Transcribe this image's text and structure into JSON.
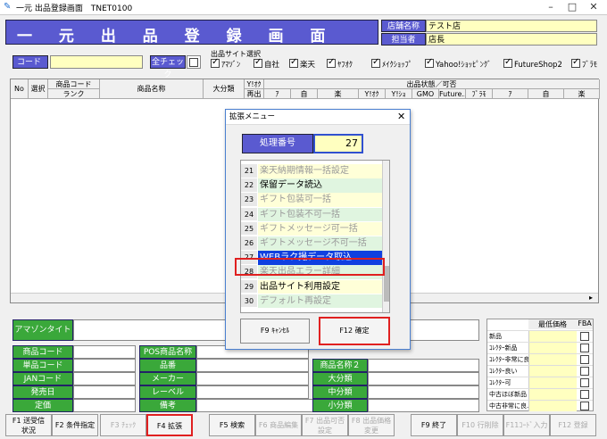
{
  "window": {
    "title": "一元 出品登録画面　TNET0100"
  },
  "header": {
    "title": "一 元 出 品 登 録 画 面",
    "store_label": "店舗名称",
    "store_value": "テスト店",
    "staff_label": "担当者",
    "staff_value": "店長"
  },
  "search": {
    "code_label": "コード",
    "all_check_label": "全チェック",
    "site_group_label": "出品サイト選択",
    "sites": [
      "ｱﾏｿﾞﾝ",
      "自社",
      "楽天",
      "ﾔﾌｵｸ",
      "ﾒｲｸｼｮｯﾌﾟ",
      "Yahoo!ｼｮｯﾋﾟﾝｸﾞ",
      "FutureShop2",
      "ﾌﾞﾗﾓ"
    ]
  },
  "grid": {
    "col_no": "No",
    "col_select": "選択",
    "col_code": "商品コード",
    "col_rank": "ランク",
    "col_name": "商品名称",
    "col_category": "大分類",
    "col_y1": "Y!ｵｸ",
    "col_y2": "再出",
    "status_group": "出品状態／可否",
    "status_cols": [
      "ｱ",
      "自",
      "楽",
      "Y!ｵｸ",
      "Y!ｼｮ",
      "GMO",
      "Future...",
      "ﾌﾞﾗﾓ",
      "ｱ",
      "自",
      "楽"
    ]
  },
  "detail": {
    "amazon_title": "アマゾンタイトル",
    "product_code": "商品コード",
    "single_code": "単品コード",
    "jan": "JANコード",
    "release": "発売日",
    "price": "定価",
    "pos_name": "POS商品名称",
    "item": "品番",
    "maker": "メーカー",
    "label": "レーベル",
    "remarks": "備考",
    "name2": "商品名称２",
    "large_cat": "大分類",
    "mid_cat": "中分類",
    "small_cat": "小分類"
  },
  "price_table": {
    "h1": "最低価格",
    "h2": "FBA",
    "rows": [
      "新品",
      "ｺﾚｸﾀｰ新品",
      "ｺﾚｸﾀｰ非常に良い",
      "ｺﾚｸﾀｰ良い",
      "ｺﾚｸﾀｰ可",
      "中古ほぼ新品",
      "中古非常に良..."
    ]
  },
  "fkeys": [
    {
      "key": "f1",
      "label": "F1 送受信\n状況",
      "enabled": true
    },
    {
      "key": "f2",
      "label": "F2 条件指定",
      "enabled": true
    },
    {
      "key": "f3",
      "label": "F3 ﾁｪｯｸ",
      "enabled": false
    },
    {
      "key": "f4",
      "label": "F4 拡張",
      "enabled": true
    },
    {
      "key": "f5",
      "label": "F5 検索",
      "enabled": true
    },
    {
      "key": "f6",
      "label": "F6 商品編集",
      "enabled": false
    },
    {
      "key": "f7",
      "label": "F7 出品可否\n設定",
      "enabled": false
    },
    {
      "key": "f8",
      "label": "F8 出品価格\n変更",
      "enabled": false
    },
    {
      "key": "f9",
      "label": "F9 終了",
      "enabled": true
    },
    {
      "key": "f10",
      "label": "F10 行削除",
      "enabled": false
    },
    {
      "key": "f11",
      "label": "F11ｺｰﾄﾞ入力",
      "enabled": false
    },
    {
      "key": "f12",
      "label": "F12 登録",
      "enabled": false
    }
  ],
  "dialog": {
    "title": "拡張メニュー",
    "proc_label": "処理番号",
    "proc_value": "27",
    "cancel": "F9 ｷｬﾝｾﾙ",
    "confirm": "F12 確定",
    "items": [
      {
        "no": "21",
        "text": "楽天納期情報一括設定",
        "enabled": false
      },
      {
        "no": "22",
        "text": "保留データ読込",
        "enabled": true
      },
      {
        "no": "23",
        "text": "ギフト包装可一括",
        "enabled": false
      },
      {
        "no": "24",
        "text": "ギフト包装不可一括",
        "enabled": false
      },
      {
        "no": "25",
        "text": "ギフトメッセージ可一括",
        "enabled": false
      },
      {
        "no": "26",
        "text": "ギフトメッセージ不可一括",
        "enabled": false
      },
      {
        "no": "27",
        "text": "WEBラク撮データ取込",
        "enabled": true,
        "selected": true
      },
      {
        "no": "28",
        "text": "楽天出品エラー詳細",
        "enabled": false
      },
      {
        "no": "29",
        "text": "出品サイト利用設定",
        "enabled": true
      },
      {
        "no": "30",
        "text": "デフォルト再設定",
        "enabled": false
      }
    ]
  }
}
